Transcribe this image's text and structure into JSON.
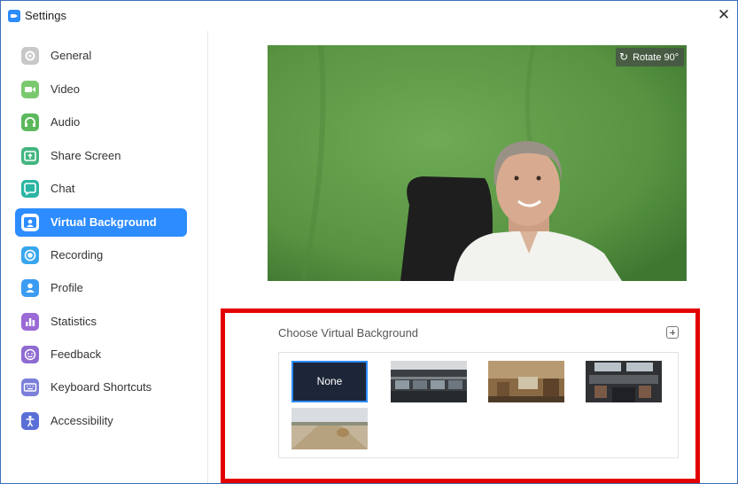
{
  "window": {
    "title": "Settings",
    "close_glyph": "✕"
  },
  "sidebar": {
    "items": [
      {
        "label": "General",
        "icon": "gear-icon",
        "color": "#c8c8c8",
        "active": false
      },
      {
        "label": "Video",
        "icon": "video-camera-icon",
        "color": "#7bc96f",
        "active": false
      },
      {
        "label": "Audio",
        "icon": "headphones-icon",
        "color": "#5cb85c",
        "active": false
      },
      {
        "label": "Share Screen",
        "icon": "share-screen-icon",
        "color": "#43b581",
        "active": false
      },
      {
        "label": "Chat",
        "icon": "chat-bubble-icon",
        "color": "#2bb5a3",
        "active": false
      },
      {
        "label": "Virtual Background",
        "icon": "person-portrait-icon",
        "color": "#2d8cff",
        "active": true
      },
      {
        "label": "Recording",
        "icon": "record-icon",
        "color": "#39a6ef",
        "active": false
      },
      {
        "label": "Profile",
        "icon": "person-icon",
        "color": "#3b9cf2",
        "active": false
      },
      {
        "label": "Statistics",
        "icon": "bar-chart-icon",
        "color": "#9b6ad6",
        "active": false
      },
      {
        "label": "Feedback",
        "icon": "smiley-icon",
        "color": "#8e6bd1",
        "active": false
      },
      {
        "label": "Keyboard Shortcuts",
        "icon": "keyboard-icon",
        "color": "#7b7fd9",
        "active": false
      },
      {
        "label": "Accessibility",
        "icon": "accessibility-icon",
        "color": "#5a6fd6",
        "active": false
      }
    ]
  },
  "preview": {
    "rotate_label": "Rotate 90°",
    "rotate_icon": "rotate-icon"
  },
  "virtual_background": {
    "heading": "Choose Virtual Background",
    "add_icon": "plus-icon",
    "thumbnails": [
      {
        "label": "None",
        "selected": true
      },
      {
        "label": "",
        "selected": false
      },
      {
        "label": "",
        "selected": false
      },
      {
        "label": "",
        "selected": false
      },
      {
        "label": "",
        "selected": false
      }
    ]
  },
  "colors": {
    "accent": "#2d8cff",
    "highlight": "#e30000",
    "green_screen": "#5c9a46"
  }
}
